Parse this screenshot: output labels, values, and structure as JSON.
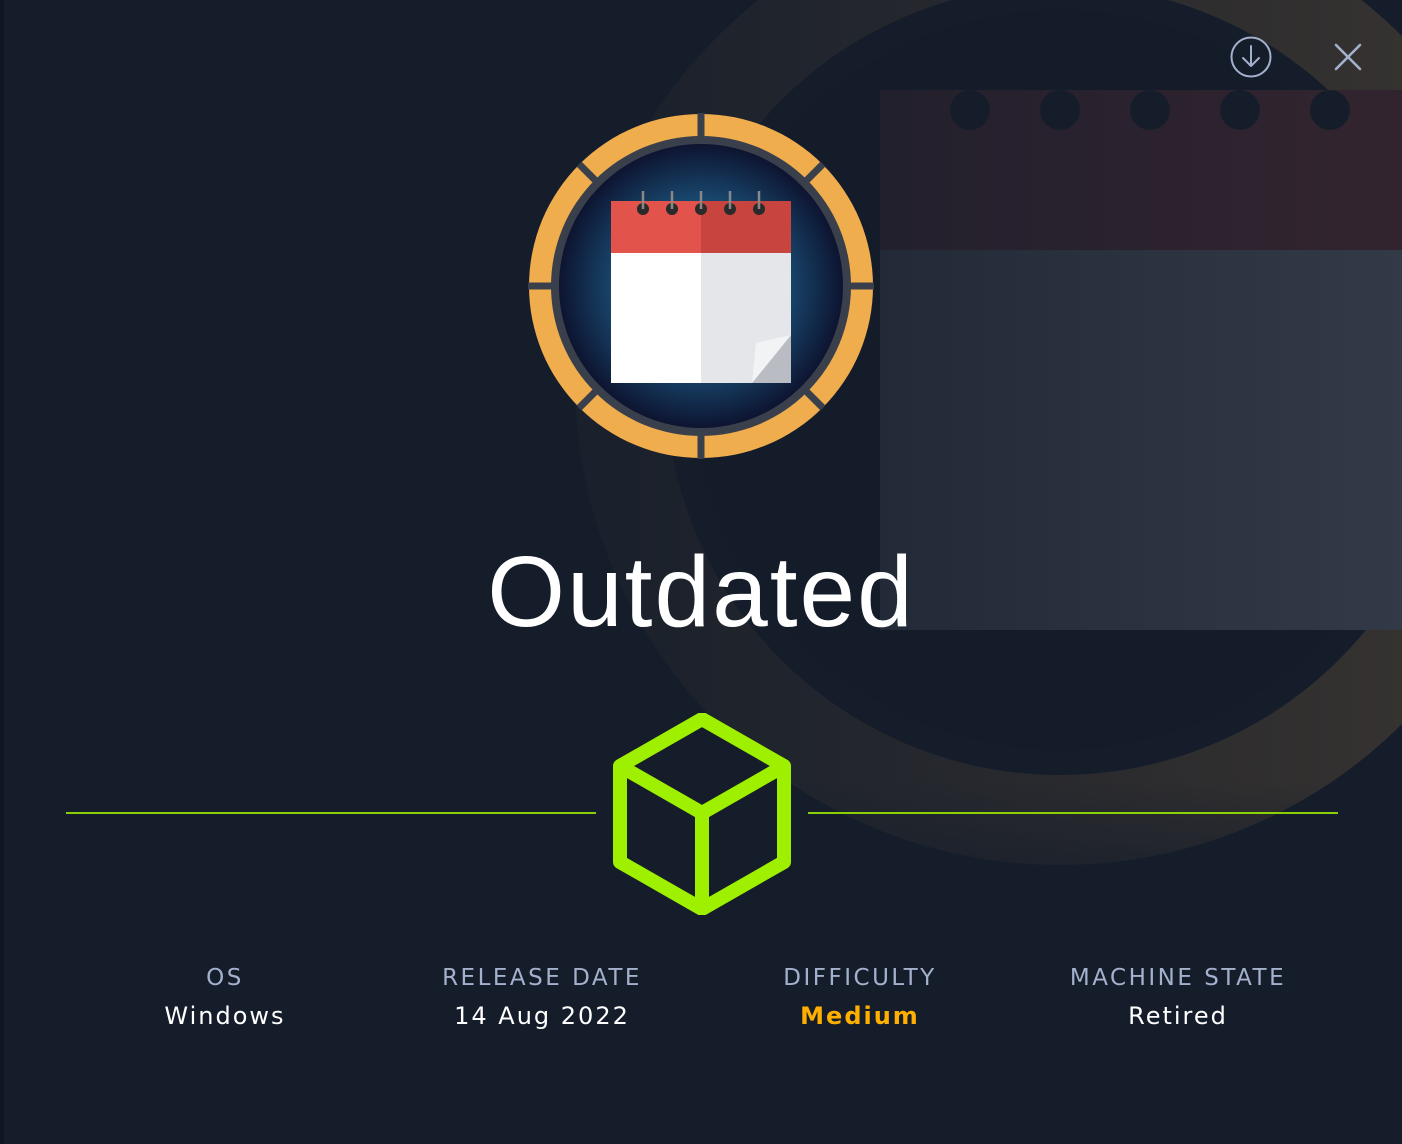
{
  "machine": {
    "name": "Outdated",
    "badge_icon": "calendar-icon",
    "category_icon": "cube-icon"
  },
  "actions": {
    "download_icon": "download-icon",
    "close_icon": "close-icon"
  },
  "stats": {
    "os_label": "OS",
    "os_value": "Windows",
    "release_label": "RELEASE DATE",
    "release_value": "14 Aug 2022",
    "difficulty_label": "DIFFICULTY",
    "difficulty_value": "Medium",
    "state_label": "MACHINE STATE",
    "state_value": "Retired"
  },
  "colors": {
    "background": "#151d2b",
    "accent_green": "#9fef00",
    "difficulty_medium": "#ffaf00",
    "badge_ring": "#f0ad4e",
    "calendar_red": "#e2534b"
  }
}
